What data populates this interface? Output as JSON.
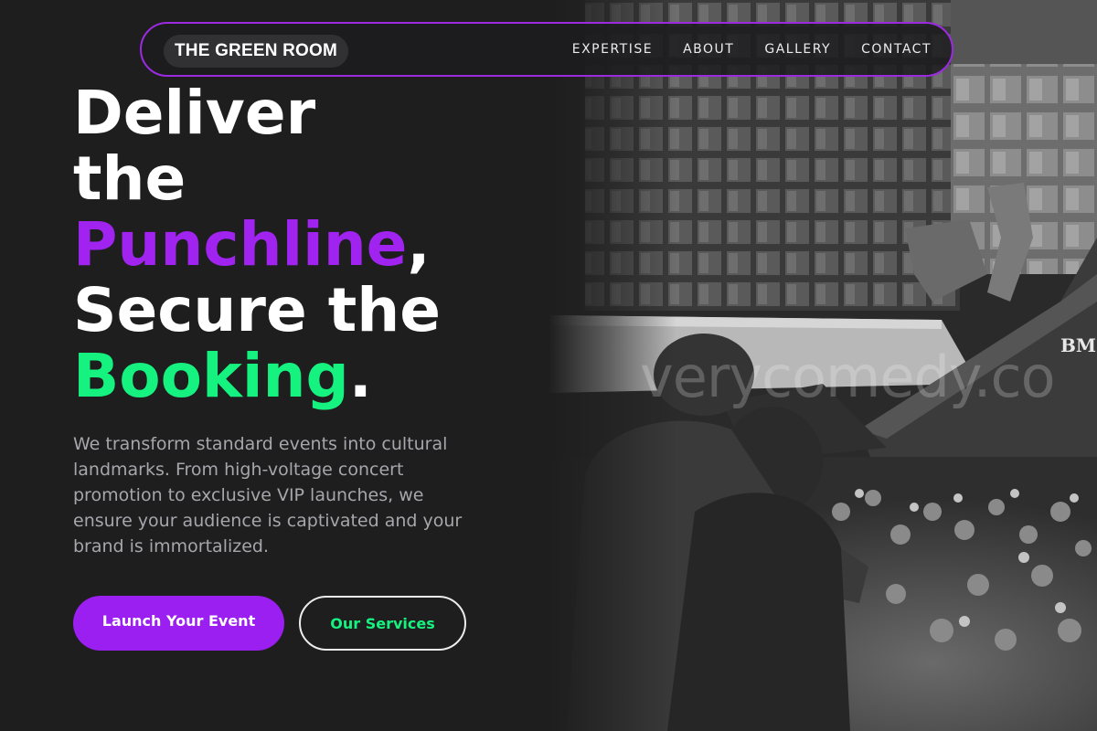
{
  "brand": {
    "logo_text": "THE GREEN ROOM"
  },
  "nav": {
    "links": [
      "EXPERTISE",
      "ABOUT",
      "GALLERY",
      "CONTACT"
    ]
  },
  "hero": {
    "headline": {
      "line1": "Deliver",
      "line2": "the",
      "line3_accent": "Punchline",
      "line3_tail": ",",
      "line4": "Secure the",
      "line5_accent": "Booking",
      "line5_tail": "."
    },
    "description": "We transform standard events into cultural landmarks. From high-voltage concert promotion to exclusive VIP launches, we ensure your audience is captivated and your brand is immortalized.",
    "primary_cta": "Launch Your Event",
    "secondary_cta": "Our Services",
    "photo": {
      "watermark": "verycomedy.co",
      "tent_logo": "BM"
    }
  },
  "colors": {
    "background": "#1e1e1f",
    "accent_purple": "#a023f0",
    "accent_green": "#16f27f",
    "nav_border": "#9b2ae0",
    "body_text": "#a6a6ab"
  },
  "icons": {
    "hero_image": "crowd-photo"
  }
}
